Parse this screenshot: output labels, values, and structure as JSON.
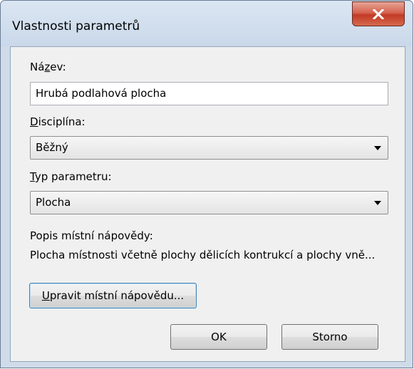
{
  "window": {
    "title": "Vlastnosti parametrů",
    "close_icon": "close-x-icon",
    "close_color": "#c7412b"
  },
  "name": {
    "label_pre": "Ná",
    "label_key": "z",
    "label_post": "ev:",
    "value": "Hrubá podlahová plocha"
  },
  "discipline": {
    "label_key": "D",
    "label_post": "isciplína:",
    "value": "Běžný"
  },
  "param_type": {
    "label_key": "T",
    "label_post": "yp parametru:",
    "value": "Plocha"
  },
  "tooltip": {
    "label": "Popis místní nápovědy:",
    "text": "Plocha místnosti včetně plochy dělicích kontrukcí a plochy vně..."
  },
  "buttons": {
    "edit_key": "U",
    "edit_post": "pravit místní nápovědu...",
    "ok": "OK",
    "cancel": "Storno"
  }
}
